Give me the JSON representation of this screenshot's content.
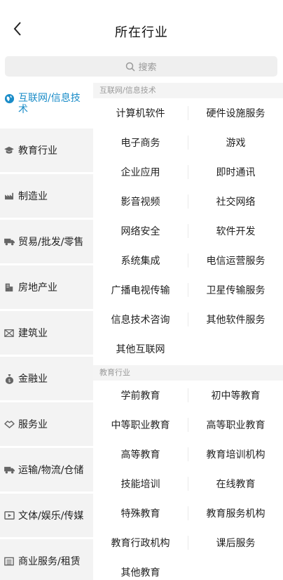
{
  "header": {
    "title": "所在行业"
  },
  "search": {
    "placeholder": "搜索"
  },
  "sidebar": {
    "items": [
      {
        "label": "互联网/信息技术",
        "icon": "globe-icon",
        "active": true
      },
      {
        "label": "教育行业",
        "icon": "graduation-cap-icon"
      },
      {
        "label": "制造业",
        "icon": "factory-icon"
      },
      {
        "label": "贸易/批发/零售",
        "icon": "truck-icon"
      },
      {
        "label": "房地产业",
        "icon": "building-icon"
      },
      {
        "label": "建筑业",
        "icon": "construction-icon"
      },
      {
        "label": "金融业",
        "icon": "money-bag-icon"
      },
      {
        "label": "服务业",
        "icon": "handshake-icon"
      },
      {
        "label": "运输/物流/仓储",
        "icon": "delivery-truck-icon"
      },
      {
        "label": "文体/娱乐/传媒",
        "icon": "screen-icon"
      },
      {
        "label": "商业服务/租赁",
        "icon": "briefcase-icon"
      }
    ]
  },
  "sections": [
    {
      "title": "互联网/信息技术",
      "items": [
        "计算机软件",
        "硬件设施服务",
        "电子商务",
        "游戏",
        "企业应用",
        "即时通讯",
        "影音视频",
        "社交网络",
        "网络安全",
        "软件开发",
        "系统集成",
        "电信运营服务",
        "广播电视传输",
        "卫星传输服务",
        "信息技术咨询",
        "其他软件服务",
        "其他互联网"
      ]
    },
    {
      "title": "教育行业",
      "items": [
        "学前教育",
        "初中等教育",
        "中等职业教育",
        "高等职业教育",
        "高等教育",
        "教育培训机构",
        "技能培训",
        "在线教育",
        "特殊教育",
        "教育服务机构",
        "教育行政机构",
        "课后服务",
        "其他教育"
      ]
    }
  ],
  "colors": {
    "accent": "#1a8cc8",
    "sidebar_bg": "#f3f3f3",
    "section_header_bg": "#f4f4f4"
  }
}
